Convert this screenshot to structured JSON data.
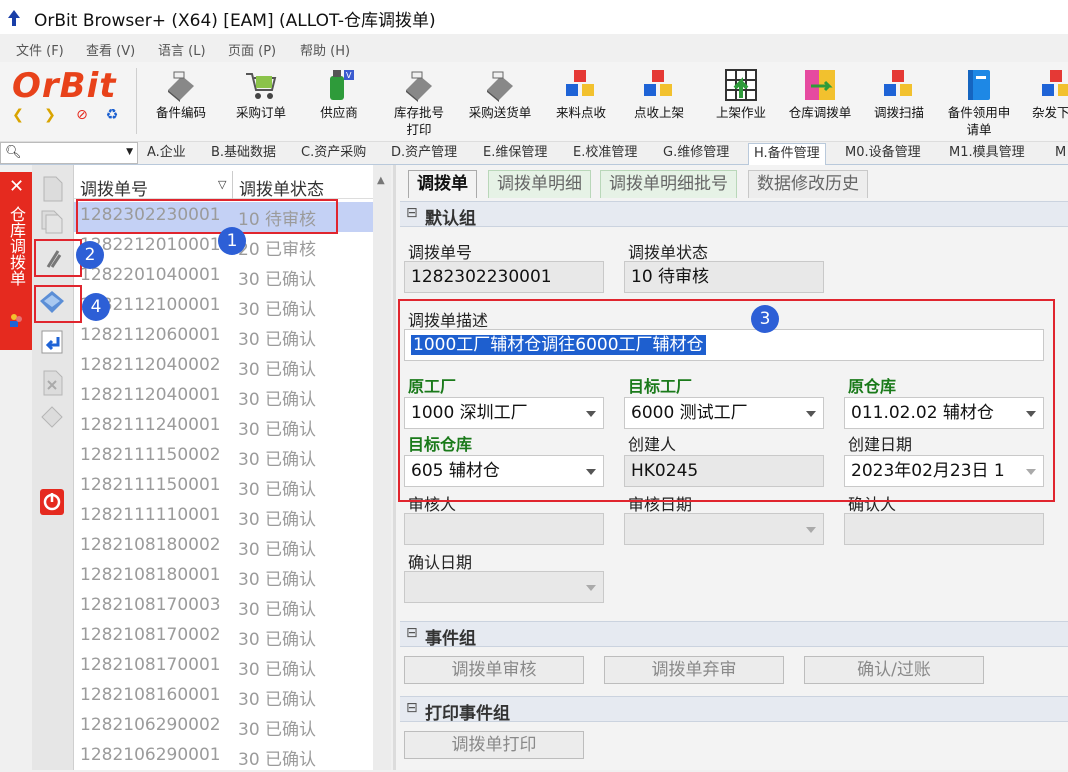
{
  "window": {
    "title": "OrBit Browser+ (X64) [EAM] (ALLOT-仓库调拨单)"
  },
  "menu": [
    "文件 (F)",
    "查看 (V)",
    "语言 (L)",
    "页面 (P)",
    "帮助 (H)"
  ],
  "logo": "OrBit",
  "toolbar": [
    {
      "label": "备件编码",
      "icon": "part-scanner-icon"
    },
    {
      "label": "采购订单",
      "icon": "shopping-cart-icon"
    },
    {
      "label": "供应商",
      "icon": "supplier-bottle-icon"
    },
    {
      "label": "库存批号打印",
      "icon": "batch-print-scanner-icon"
    },
    {
      "label": "采购送货单",
      "icon": "delivery-scanner-icon"
    },
    {
      "label": "来料点收",
      "icon": "incoming-cubes-icon"
    },
    {
      "label": "点收上架",
      "icon": "receive-shelf-cubes-icon"
    },
    {
      "label": "上架作业",
      "icon": "shelving-grid-icon"
    },
    {
      "label": "仓库调拨单",
      "icon": "warehouse-transfer-icon"
    },
    {
      "label": "调拨扫描",
      "icon": "transfer-scan-cubes-icon"
    },
    {
      "label": "备件领用申请单",
      "icon": "requisition-book-icon"
    },
    {
      "label": "杂发下",
      "icon": "misc-issue-cubes-icon"
    }
  ],
  "module_tabs": [
    "A.企业",
    "B.基础数据",
    "C.资产采购",
    "D.资产管理",
    "E.维保管理",
    "E.校准管理",
    "G.维修管理",
    "H.备件管理",
    "M0.设备管理",
    "M1.模具管理",
    "M"
  ],
  "active_module_tab": "H.备件管理",
  "side_panel": {
    "title": "仓库调拨单",
    "close": "✕"
  },
  "list": {
    "columns": [
      "调拨单号",
      "调拨单状态"
    ],
    "rows": [
      [
        "1282302230001",
        "10  待审核"
      ],
      [
        "1282212010001",
        "20  已审核"
      ],
      [
        "1282201040001",
        "30  已确认"
      ],
      [
        "1282112100001",
        "30  已确认"
      ],
      [
        "1282112060001",
        "30  已确认"
      ],
      [
        "1282112040002",
        "30  已确认"
      ],
      [
        "1282112040001",
        "30  已确认"
      ],
      [
        "1282111240001",
        "30  已确认"
      ],
      [
        "1282111150002",
        "30  已确认"
      ],
      [
        "1282111150001",
        "30  已确认"
      ],
      [
        "1282111110001",
        "30  已确认"
      ],
      [
        "1282108180002",
        "30  已确认"
      ],
      [
        "1282108180001",
        "30  已确认"
      ],
      [
        "1282108170003",
        "30  已确认"
      ],
      [
        "1282108170002",
        "30  已确认"
      ],
      [
        "1282108170001",
        "30  已确认"
      ],
      [
        "1282108160001",
        "30  已确认"
      ],
      [
        "1282106290002",
        "30  已确认"
      ],
      [
        "1282106290001",
        "30  已确认"
      ]
    ]
  },
  "detail_tabs": [
    "调拨单",
    "调拨单明细",
    "调拨单明细批号",
    "数据修改历史"
  ],
  "groups": {
    "default": "默认组",
    "events": "事件组",
    "print": "打印事件组"
  },
  "form": {
    "order_no": {
      "label": "调拨单号",
      "value": "1282302230001"
    },
    "status": {
      "label": "调拨单状态",
      "value": "10  待审核"
    },
    "description": {
      "label": "调拨单描述",
      "value": "1000工厂辅材仓调往6000工厂辅材仓"
    },
    "source_plant": {
      "label": "原工厂",
      "value": "1000 深圳工厂"
    },
    "target_plant": {
      "label": "目标工厂",
      "value": "6000 测试工厂"
    },
    "source_wh": {
      "label": "原仓库",
      "value": "011.02.02 辅材仓"
    },
    "target_wh": {
      "label": "目标仓库",
      "value": "605 辅材仓"
    },
    "creator": {
      "label": "创建人",
      "value": "HK0245"
    },
    "create_date": {
      "label": "创建日期",
      "value": "2023年02月23日 1"
    },
    "auditor": {
      "label": "审核人",
      "value": ""
    },
    "audit_date": {
      "label": "审核日期",
      "value": ""
    },
    "confirmer": {
      "label": "确认人",
      "value": ""
    },
    "confirm_date": {
      "label": "确认日期",
      "value": ""
    }
  },
  "buttons": {
    "audit": "调拨单审核",
    "abandon": "调拨单弃审",
    "confirm": "确认/过账",
    "print": "调拨单打印"
  },
  "annotations": [
    "1",
    "2",
    "3",
    "4"
  ],
  "colors": {
    "accent_red": "#e52a1f",
    "badge_blue": "#2d5fd6",
    "selected_row": "#c4d1f5"
  }
}
